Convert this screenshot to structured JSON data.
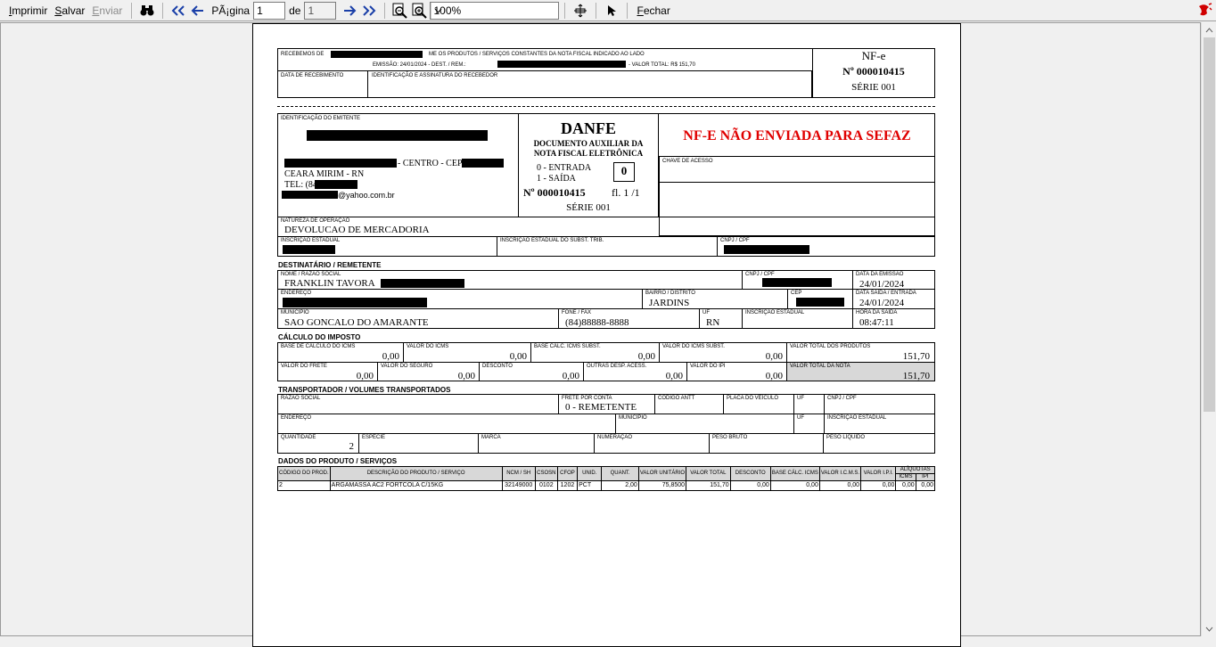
{
  "toolbar": {
    "print": "Imprimir",
    "save": "Salvar",
    "send": "Enviar",
    "page_label": "PÃ¡gina",
    "page_current": "1",
    "of_label": "de",
    "page_total": "1",
    "zoom": "100%",
    "close": "Fechar"
  },
  "receipt": {
    "received_from": "RECEBEMOS DE",
    "received_text": "ME OS PRODUTOS / SERVIÇOS CONSTANTES DA NOTA FISCAL INDICADO AO LADO",
    "emission": "EMISSÃO: 24/01/2024  -  DEST. / REM.:",
    "total": "-  VALOR TOTAL: R$ 151,70",
    "date_label": "DATA DE RECEBIMENTO",
    "signature_label": "IDENTIFICAÇÃO E ASSINATURA DO RECEBEDOR",
    "nfe": "NF-e",
    "number": "Nº 000010415",
    "series": "SÉRIE 001"
  },
  "emitter": {
    "label": "IDENTIFICAÇÃO DO EMITENTE",
    "address_suffix": "- CENTRO - CEP:",
    "city": "CEARA MIRIM - RN",
    "phone": "TEL: (84)",
    "email_suffix": "@yahoo.com.br"
  },
  "danfe": {
    "title": "DANFE",
    "subtitle1": "DOCUMENTO AUXILIAR DA",
    "subtitle2": "NOTA FISCAL ELETRÔNICA",
    "entry": "0 - ENTRADA",
    "exit": "1 - SAÍDA",
    "type_value": "0",
    "number": "Nº 000010415",
    "sheet": "fl. 1  /1",
    "series": "SÉRIE 001",
    "warning": "NF-E NÃO ENVIADA PARA SEFAZ",
    "access_key_label": "CHAVE DE ACESSO",
    "warning_color": "#e00000"
  },
  "operation": {
    "nature_label": "NATUREZA DE OPERAÇÃO",
    "nature": "DEVOLUCAO DE MERCADORIA",
    "ie_label": "INSCRIÇÃO ESTADUAL",
    "ie_st_label": "INSCRIÇÃO ESTADUAL DO SUBST. TRIB.",
    "cnpj_label": "CNPJ / CPF"
  },
  "recipient": {
    "section": "DESTINATÁRIO / REMETENTE",
    "name_label": "NOME / RAZÃO SOCIAL",
    "name": "FRANKLIN TAVORA",
    "cnpj_label": "CNPJ / CPF",
    "emission_label": "DATA DA EMISSÃO",
    "emission": "24/01/2024",
    "address_label": "ENDEREÇO",
    "district_label": "BAIRRO / DISTRITO",
    "district": "JARDINS",
    "cep_label": "CEP",
    "exit_date_label": "DATA SAÍDA / ENTRADA",
    "exit_date": "24/01/2024",
    "city_label": "MUNICÍPIO",
    "city": "SAO GONCALO DO AMARANTE",
    "phone_label": "FONE / FAX",
    "phone": "(84)88888-8888",
    "uf_label": "UF",
    "uf": "RN",
    "ie_label": "INSCRIÇÃO ESTADUAL",
    "time_label": "HORA DA SAÍDA",
    "time": "08:47:11"
  },
  "tax": {
    "section": "CÁLCULO DO IMPOSTO",
    "base_icms_label": "BASE DE CÁLCULO DO ICMS",
    "base_icms": "0,00",
    "icms_label": "VALOR DO ICMS",
    "icms": "0,00",
    "base_st_label": "BASE CÁLC. ICMS SUBST.",
    "base_st": "0,00",
    "icms_st_label": "VALOR DO ICMS SUBST.",
    "icms_st": "0,00",
    "products_label": "VALOR TOTAL DOS PRODUTOS",
    "products": "151,70",
    "freight_label": "VALOR DO FRETE",
    "freight": "0,00",
    "insurance_label": "VALOR DO SEGURO",
    "insurance": "0,00",
    "discount_label": "DESCONTO",
    "discount": "0,00",
    "other_label": "OUTRAS DESP. ACESS.",
    "other": "0,00",
    "ipi_label": "VALOR DO IPI",
    "ipi": "0,00",
    "total_label": "VALOR TOTAL DA NOTA",
    "total": "151,70"
  },
  "transport": {
    "section": "TRANSPORTADOR / VOLUMES TRANSPORTADOS",
    "name_label": "RAZÃO SOCIAL",
    "freight_label": "FRETE POR CONTA",
    "freight": "0 - REMETENTE",
    "antt_label": "CÓDIGO ANTT",
    "plate_label": "PLACA DO VEÍCULO",
    "uf_label": "UF",
    "cnpj_label": "CNPJ / CPF",
    "address_label": "ENDEREÇO",
    "city_label": "MUNICÍPIO",
    "uf2_label": "UF",
    "ie_label": "INSCRIÇÃO ESTADUAL",
    "qty_label": "QUANTIDADE",
    "qty": "2",
    "species_label": "ESPÉCIE",
    "brand_label": "MARCA",
    "numbering_label": "NUMERAÇÃO",
    "gross_label": "PESO BRUTO",
    "net_label": "PESO LÍQUIDO"
  },
  "products": {
    "section": "DADOS DO PRODUTO / SERVIÇOS",
    "headers": [
      "CÓDIGO DO PROD.",
      "DESCRIÇÃO DO PRODUTO / SERVIÇO",
      "NCM / SH",
      "CSOSN",
      "CFOP",
      "UNID.",
      "QUANT.",
      "VALOR UNITÁRIO",
      "VALOR TOTAL",
      "DESCONTO",
      "BASE CÁLC. ICMS",
      "VALOR I.C.M.S.",
      "VALOR I.P.I.",
      "ALÍQUOTAS",
      "ICMS",
      "IPI"
    ],
    "rows": [
      [
        "2",
        "ARGAMASSA AC2 FORTCOLA C/15KG",
        "32149000",
        "0102",
        "1202",
        "PCT",
        "2,00",
        "75,8500",
        "151,70",
        "0,00",
        "0,00",
        "0,00",
        "0,00",
        "0,00",
        "0,00"
      ]
    ]
  }
}
